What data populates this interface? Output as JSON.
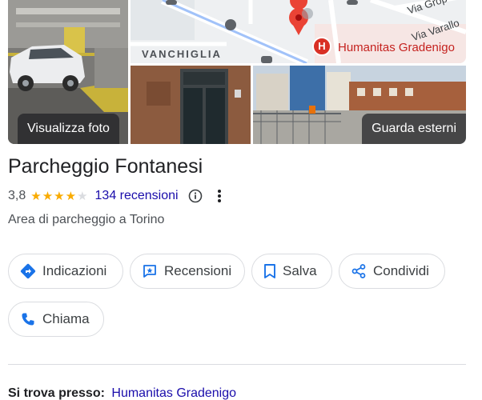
{
  "photos": {
    "left_label": "Visualizza foto",
    "right_label": "Guarda esterni"
  },
  "map": {
    "district": "VANCHIGLIA",
    "street_1": "Via Varallo",
    "street_2": "Via Grop",
    "poi_label": "Humanitas Gradenigo",
    "poi_badge": "H"
  },
  "place": {
    "title": "Parcheggio Fontanesi",
    "rating": "3,8",
    "stars_full": 4,
    "stars_total": 5,
    "reviews_label": "134 recensioni",
    "category": "Area di parcheggio a Torino"
  },
  "actions": {
    "directions": "Indicazioni",
    "reviews": "Recensioni",
    "save": "Salva",
    "share": "Condividi",
    "call": "Chiama"
  },
  "location": {
    "label": "Si trova presso:",
    "link": "Humanitas Gradenigo"
  },
  "colors": {
    "accent_blue": "#1a73e8",
    "link": "#1a0dab",
    "star": "#f9ab00",
    "pin": "#d93025"
  }
}
